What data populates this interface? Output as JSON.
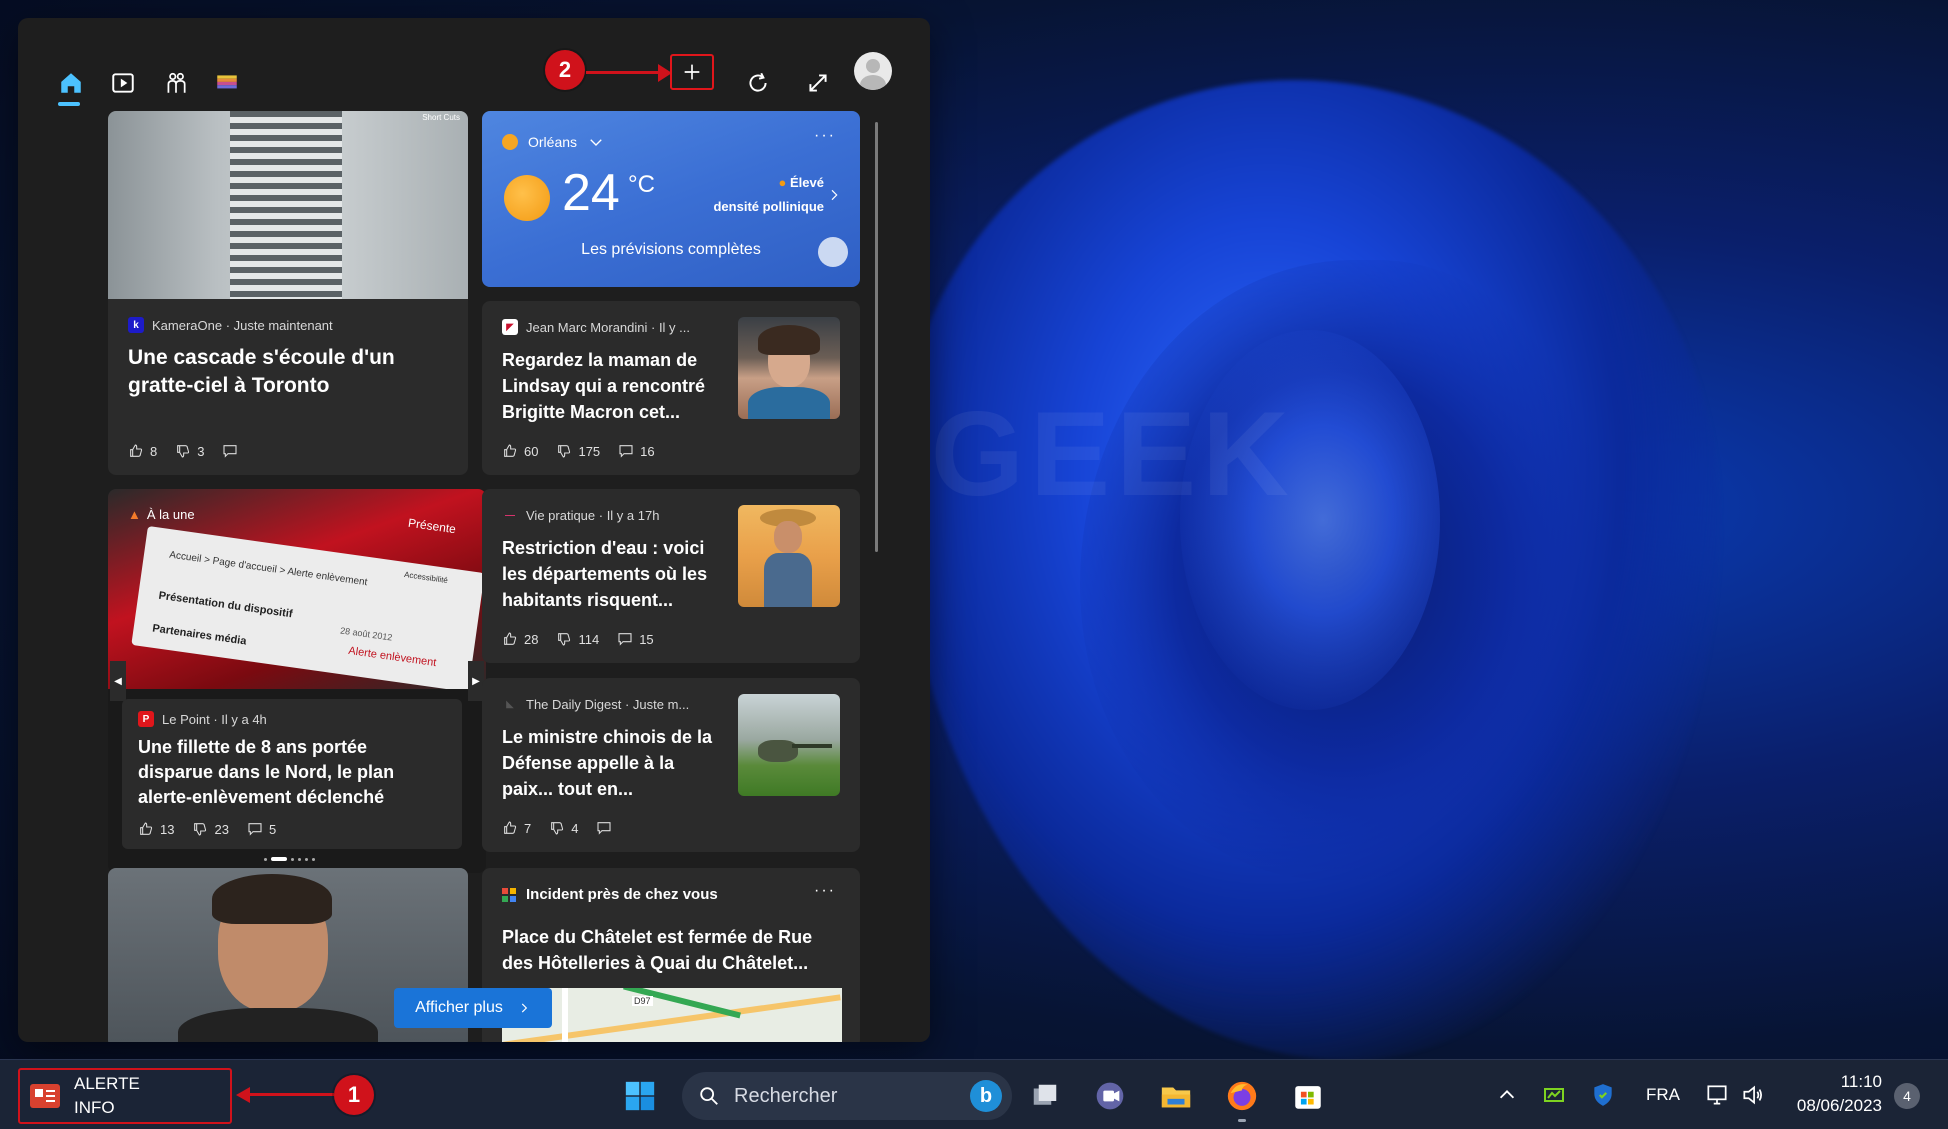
{
  "colors": {
    "accent": "#4cc2ff",
    "highlight_red": "#d0121b",
    "weather_blue": "#3b6fd4",
    "afficher_blue": "#1a74d8"
  },
  "panel": {
    "toolbar_icons": [
      "home-icon",
      "video-icon",
      "sports-icon",
      "palette-icon",
      "add-icon",
      "refresh-icon",
      "expand-icon",
      "profile-avatar"
    ],
    "badge_two": "2",
    "cards": {
      "card1": {
        "image_caption": "Short Cuts",
        "source": "KameraOne · Juste maintenant",
        "source_logo": "k",
        "headline": "Une cascade s'écoule d'un gratte-ciel à Toronto",
        "likes": "8",
        "dislikes": "3",
        "comments": ""
      },
      "weather": {
        "location": "Orléans",
        "temp": "24",
        "unit": "°C",
        "pollen_level": "Élevé",
        "pollen_label": "densité pollinique",
        "forecast_link": "Les prévisions complètes"
      },
      "card2": {
        "source": "Jean Marc Morandini · Il y ...",
        "headline": "Regardez la maman de Lindsay qui a rencontré Brigitte Macron cet...",
        "likes": "60",
        "dislikes": "175",
        "comments": "16"
      },
      "card3": {
        "tag": "À la une",
        "source": "Le Point · Il y a 4h",
        "source_logo": "P",
        "headline": "Une fillette de 8 ans portée disparue dans le Nord, le plan alerte-enlèvement déclenché",
        "likes": "13",
        "dislikes": "23",
        "comments": "5",
        "image_text": [
          "Accueil > Page d'accueil > Alerte enlèvement",
          "Présentation du dispositif",
          "Partenaires média",
          "Alerte enlèvement",
          "28 août 2012",
          "Présente",
          "Accessibilité"
        ]
      },
      "card4": {
        "source": "Vie pratique · Il y a 17h",
        "headline": "Restriction d'eau : voici les départements où les habitants risquent...",
        "likes": "28",
        "dislikes": "114",
        "comments": "15"
      },
      "card5": {
        "source": "The Daily Digest · Juste m...",
        "headline": "Le ministre chinois de la Défense appelle à la paix... tout en...",
        "likes": "7",
        "dislikes": "4",
        "comments": ""
      },
      "card6": {
        "title": "Incident près de chez vous",
        "headline": "Place du Châtelet est fermée de Rue des Hôtelleries à Quai du Châtelet...",
        "road_label": "D97"
      }
    },
    "show_more": "Afficher plus"
  },
  "watermark": "JUSTGEEK",
  "taskbar": {
    "widget_line1": "ALERTE",
    "widget_line2": "INFO",
    "badge_one": "1",
    "search_placeholder": "Rechercher",
    "language": "FRA",
    "time": "11:10",
    "date": "08/06/2023",
    "notifications": "4"
  }
}
